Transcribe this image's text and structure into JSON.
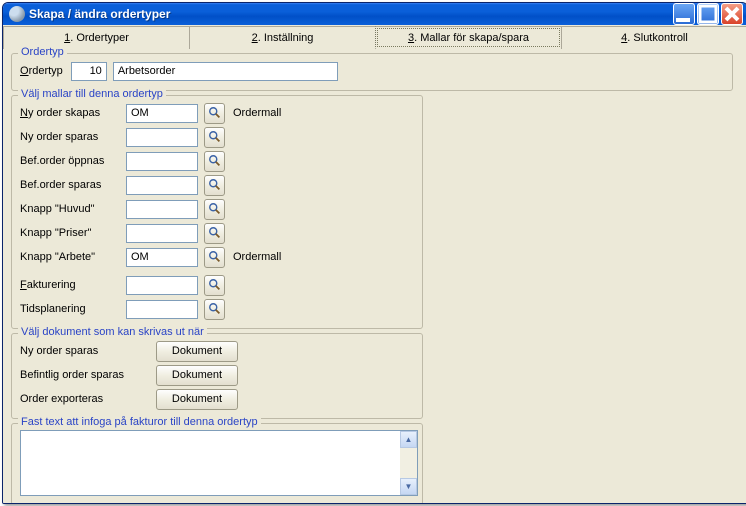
{
  "window": {
    "title": "Skapa / ändra ordertyper"
  },
  "tabs": [
    {
      "pre": "1",
      "label": ". Ordertyper"
    },
    {
      "pre": "2",
      "label": ". Inställning"
    },
    {
      "pre": "3",
      "label": ". Mallar för skapa/spara"
    },
    {
      "pre": "4",
      "label": ". Slutkontroll"
    }
  ],
  "ordertyp_group": {
    "legend": "Ordertyp",
    "label_pre": "O",
    "label": "rdertyp",
    "code": "10",
    "name": "Arbetsorder"
  },
  "templates_group": {
    "legend": "Välj mallar till denna ordertyp",
    "rows": [
      {
        "key": "ny_order_skapas",
        "pre": "N",
        "label": "y order skapas",
        "value": "OM",
        "value_label": "Ordermall"
      },
      {
        "key": "ny_order_sparas",
        "pre": "",
        "label": "Ny order sparas",
        "value": "",
        "value_label": ""
      },
      {
        "key": "bef_order_oppnas",
        "pre": "",
        "label": "Bef.order öppnas",
        "value": "",
        "value_label": ""
      },
      {
        "key": "bef_order_sparas",
        "pre": "",
        "label": "Bef.order sparas",
        "value": "",
        "value_label": ""
      },
      {
        "key": "knapp_huvud",
        "pre": "",
        "label": "Knapp \"Huvud\"",
        "value": "",
        "value_label": ""
      },
      {
        "key": "knapp_priser",
        "pre": "",
        "label": "Knapp \"Priser\"",
        "value": "",
        "value_label": ""
      },
      {
        "key": "knapp_arbete",
        "pre": "",
        "label": "Knapp \"Arbete\"",
        "value": "OM",
        "value_label": "Ordermall"
      }
    ],
    "extra_rows": [
      {
        "key": "fakturering",
        "pre": "F",
        "label": "akturering",
        "value": ""
      },
      {
        "key": "tidsplanering",
        "pre": "",
        "label": "Tidsplanering",
        "value": ""
      }
    ]
  },
  "docs_group": {
    "legend": "Välj dokument som kan skrivas ut när",
    "button_label": "Dokument",
    "rows": [
      {
        "key": "ny_order_sparas_doc",
        "label": "Ny order sparas"
      },
      {
        "key": "befintlig_order_sparas_doc",
        "label": "Befintlig order sparas"
      },
      {
        "key": "order_exporteras_doc",
        "label": "Order exporteras"
      }
    ]
  },
  "fasttext_group": {
    "legend": "Fast text att infoga på fakturor till denna ordertyp",
    "value": ""
  }
}
